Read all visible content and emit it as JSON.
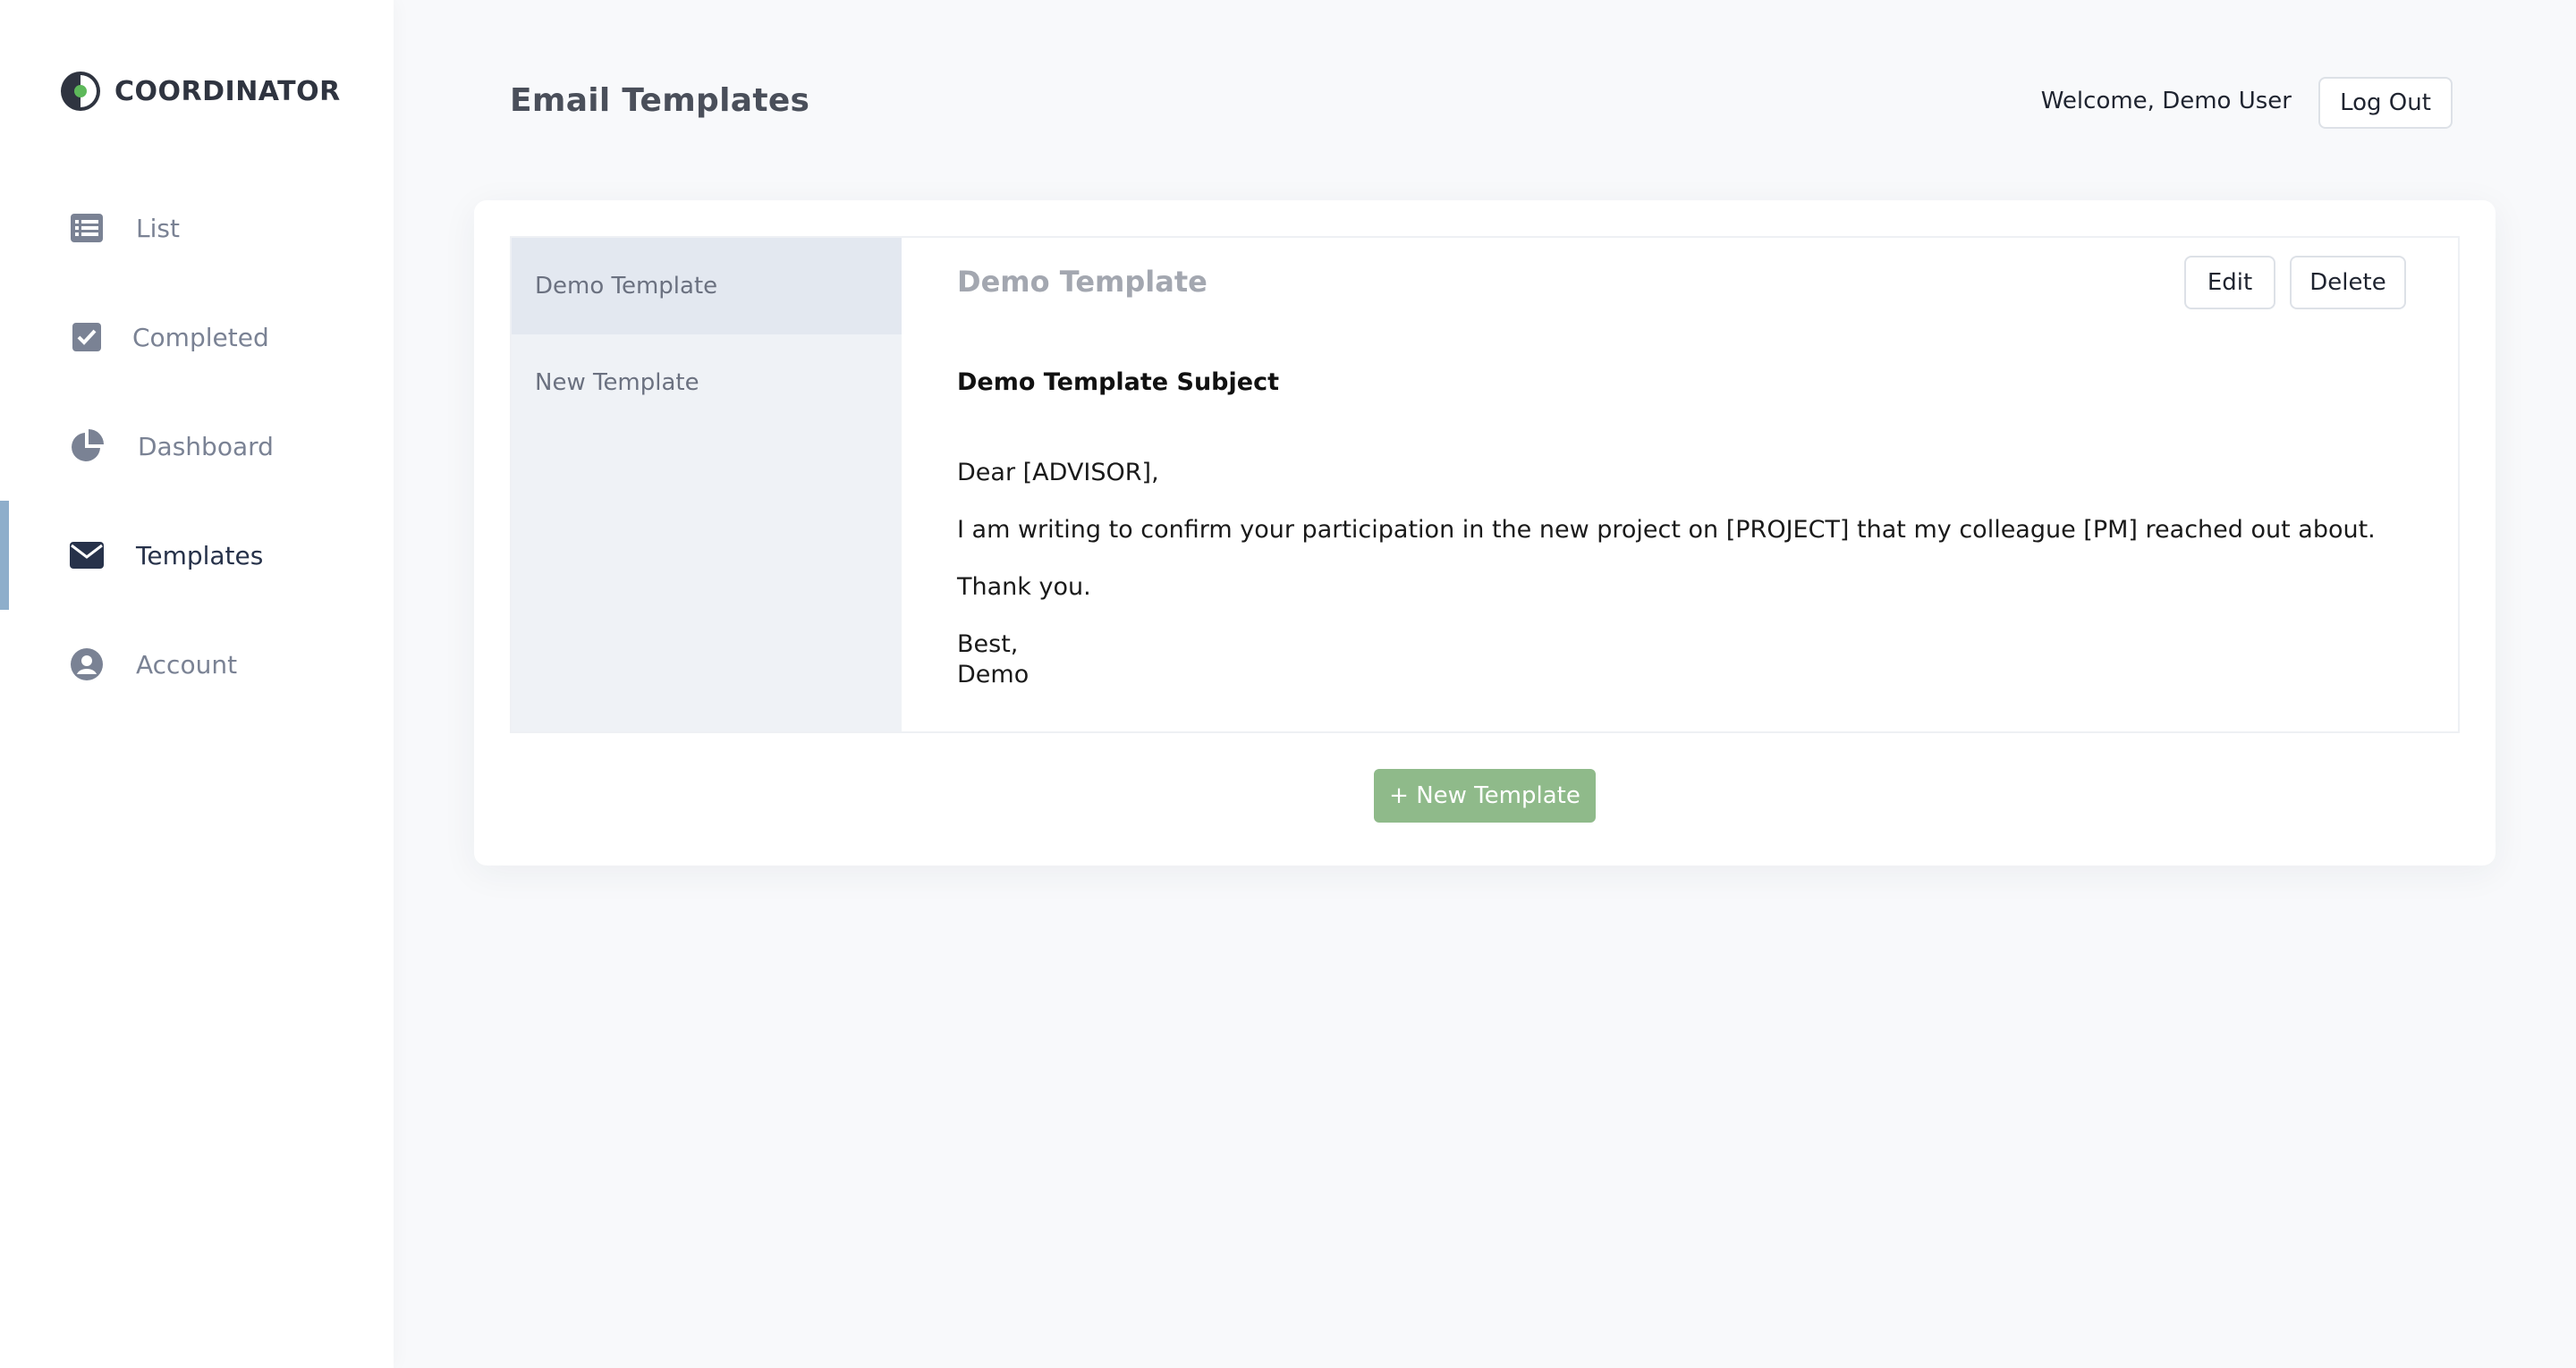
{
  "app": {
    "brand": "COORDINATOR",
    "colors": {
      "accent": "#8eaecb",
      "primary_button": "#8fba8a",
      "logo_dot": "#5db85a"
    }
  },
  "sidebar": {
    "items": [
      {
        "label": "List",
        "icon": "list-icon"
      },
      {
        "label": "Completed",
        "icon": "checkbox-icon"
      },
      {
        "label": "Dashboard",
        "icon": "pie-chart-icon"
      },
      {
        "label": "Templates",
        "icon": "envelope-icon",
        "active": true
      },
      {
        "label": "Account",
        "icon": "user-circle-icon"
      }
    ]
  },
  "header": {
    "title": "Email Templates",
    "welcome": "Welcome, Demo User",
    "logout_label": "Log Out"
  },
  "templates": {
    "list": [
      {
        "name": "Demo Template",
        "selected": true
      },
      {
        "name": "New Template",
        "selected": false
      }
    ],
    "selected": {
      "title": "Demo Template",
      "edit_label": "Edit",
      "delete_label": "Delete",
      "subject": "Demo Template Subject",
      "body": {
        "greeting": "Dear [ADVISOR],",
        "line1": "I am writing to confirm your participation in the new project on [PROJECT] that my colleague [PM] reached out about.",
        "line2": "Thank you.",
        "signoff": "Best,",
        "signature": "Demo"
      }
    },
    "new_button_label": "+ New Template"
  }
}
